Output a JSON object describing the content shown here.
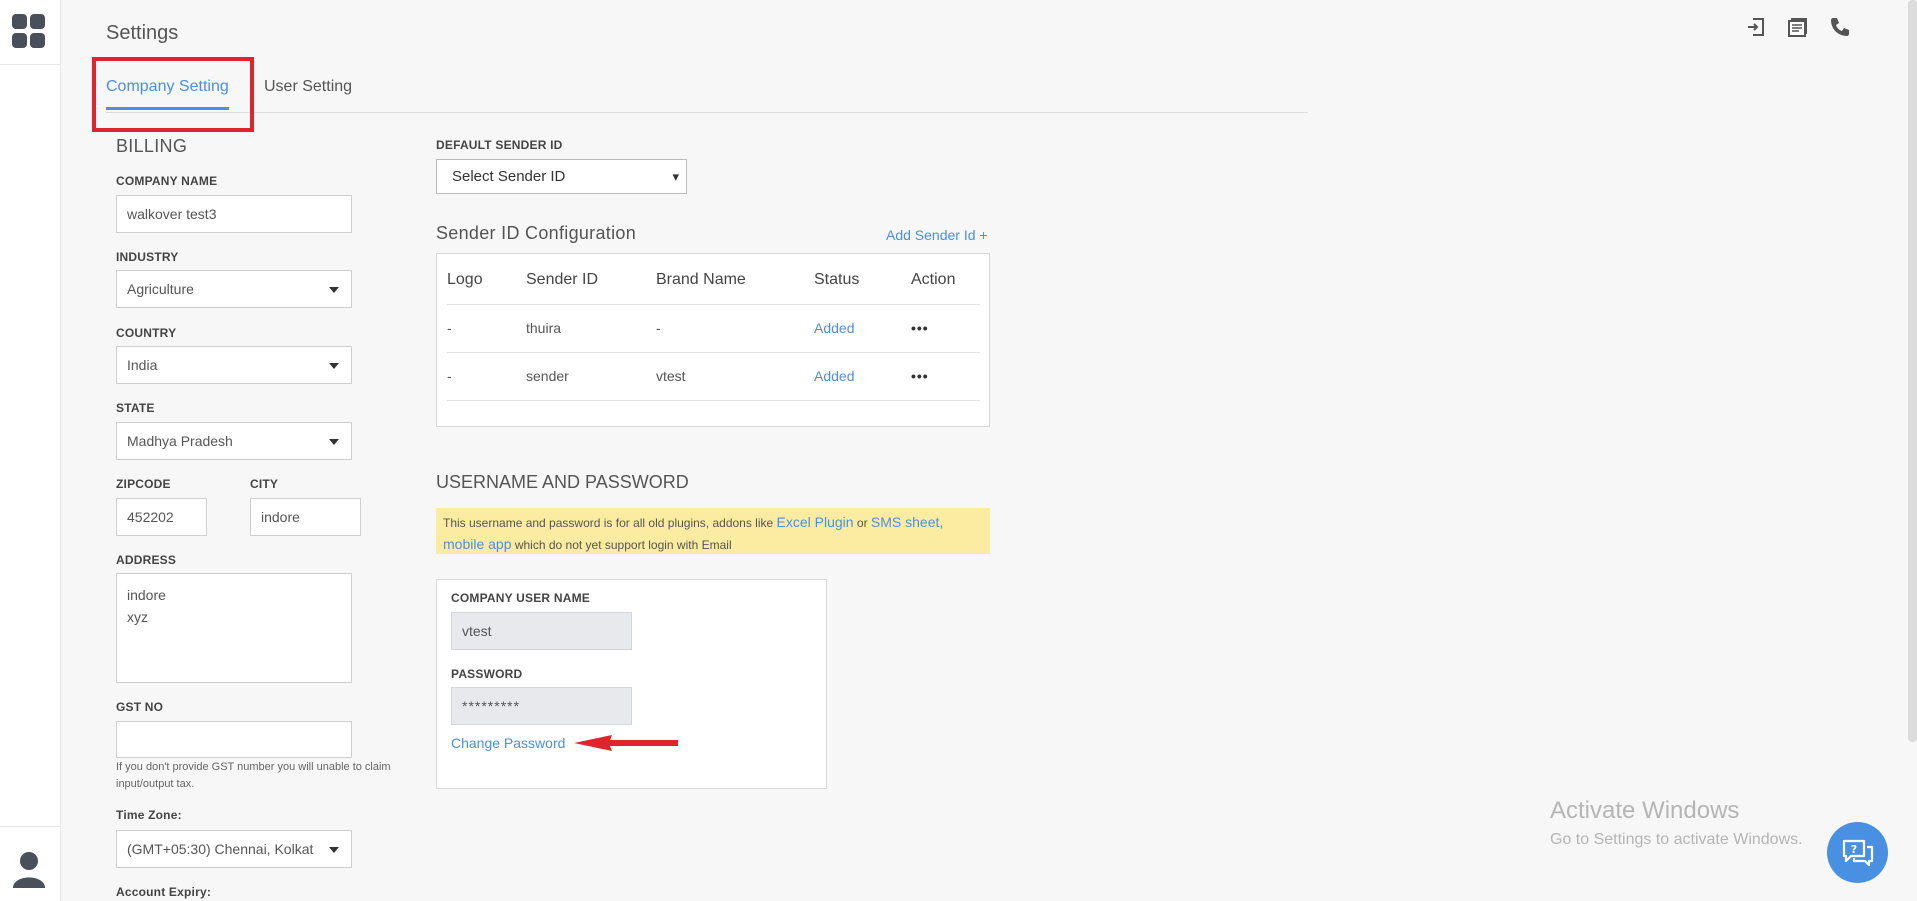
{
  "page": {
    "title": "Settings"
  },
  "tabs": [
    {
      "label": "Company Setting",
      "active": true
    },
    {
      "label": "User Setting",
      "active": false
    }
  ],
  "topbar": {
    "icons": [
      "logout-icon",
      "message-icon",
      "phone-icon"
    ]
  },
  "billing": {
    "heading": "BILLING",
    "company_name": {
      "label": "COMPANY NAME",
      "value": "walkover test3"
    },
    "industry": {
      "label": "INDUSTRY",
      "value": "Agriculture"
    },
    "country": {
      "label": "COUNTRY",
      "value": "India"
    },
    "state": {
      "label": "STATE",
      "value": "Madhya Pradesh"
    },
    "zipcode": {
      "label": "ZIPCODE",
      "value": "452202"
    },
    "city": {
      "label": "CITY",
      "value": "indore"
    },
    "address": {
      "label": "ADDRESS",
      "value": "indore\nxyz"
    },
    "gst": {
      "label": "GST NO",
      "value": "",
      "hint": "If you don't provide GST number you will unable to claim input/output tax."
    },
    "timezone": {
      "label": "Time Zone:",
      "value": "(GMT+05:30) Chennai, Kolkat"
    },
    "expiry": {
      "label": "Account Expiry:"
    }
  },
  "sender": {
    "default_label": "DEFAULT SENDER ID",
    "select_value": "Select Sender ID",
    "config_heading": "Sender ID Configuration",
    "add_link": "Add Sender Id +",
    "columns": [
      "Logo",
      "Sender ID",
      "Brand Name",
      "Status",
      "Action"
    ],
    "rows": [
      {
        "logo": "-",
        "sender_id": "thuira",
        "brand": "-",
        "status": "Added",
        "action": "•••"
      },
      {
        "logo": "-",
        "sender_id": "sender",
        "brand": "vtest",
        "status": "Added",
        "action": "•••"
      }
    ]
  },
  "credentials": {
    "heading": "USERNAME AND PASSWORD",
    "notice_pre": "This username and password is for all old plugins, addons like ",
    "notice_link1": "Excel Plugin",
    "notice_or": " or ",
    "notice_link2": "SMS sheet, mobile app",
    "notice_post": " which do not yet support login with Email",
    "username_label": "COMPANY USER NAME",
    "username_value": "vtest",
    "password_label": "PASSWORD",
    "password_value": "*********",
    "change_password": "Change Password"
  },
  "watermark": {
    "line1": "Activate Windows",
    "line2": "Go to Settings to activate Windows."
  },
  "colors": {
    "accent": "#4a90e2",
    "highlight": "#e0242b",
    "notice_bg": "#fbeca1"
  }
}
